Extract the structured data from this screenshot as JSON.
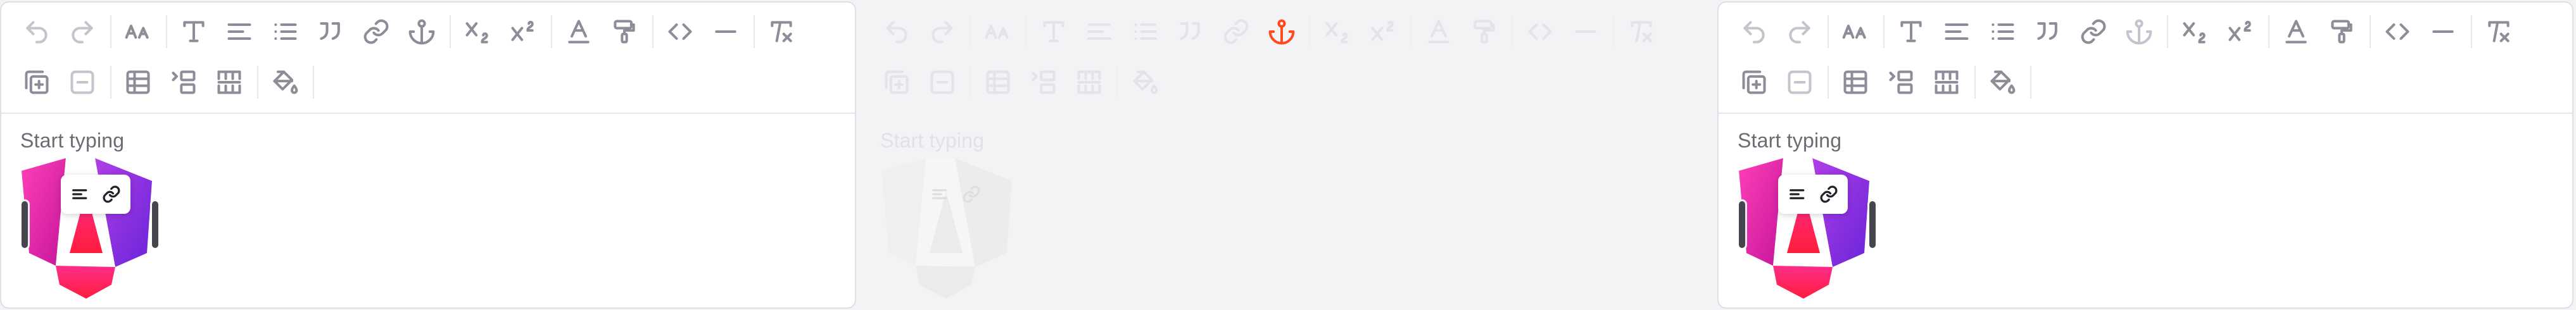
{
  "editors": [
    {
      "id": "editor-1",
      "placeholder": "Start typing",
      "active_tool": null
    },
    {
      "id": "editor-2",
      "placeholder": "Start typing",
      "active_tool": "anchor",
      "state": "dimmed"
    },
    {
      "id": "editor-3",
      "placeholder": "Start typing",
      "active_tool": null
    }
  ],
  "toolbar": {
    "row1": [
      "undo-icon",
      "redo-icon",
      "font-size-icon",
      "text-style-icon",
      "align-icon",
      "list-icon",
      "blockquote-icon",
      "link-icon",
      "anchor-icon",
      "subscript-icon",
      "superscript-icon",
      "text-color-icon",
      "paint-format-icon",
      "code-icon",
      "horizontal-rule-icon",
      "clear-format-icon"
    ],
    "row2": [
      "insert-row-icon",
      "remove-icon",
      "table-icon",
      "insert-column-icon",
      "merge-cells-icon",
      "fill-color-icon"
    ]
  },
  "image_popover": [
    "align-left-icon",
    "link-icon"
  ],
  "colors": {
    "icon": "#8d8d99",
    "icon_disabled": "#c4c4cc",
    "active": "#ff4b1f",
    "border": "#dedee6",
    "logo_magenta": "#e8259b",
    "logo_purple": "#7b2fe0",
    "logo_red": "#ff1f4c"
  }
}
